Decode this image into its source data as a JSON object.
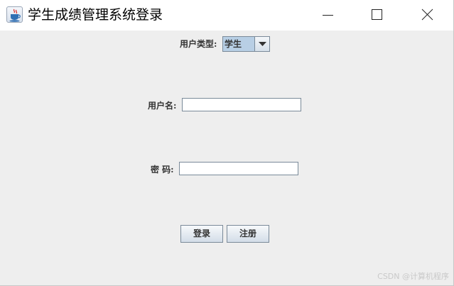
{
  "window": {
    "title": "学生成绩管理系统登录",
    "app_icon": "java-cup-icon",
    "controls": [
      "minimize-icon",
      "maximize-icon",
      "close-icon"
    ]
  },
  "form": {
    "user_type_label": "用户类型:",
    "user_type_value": "学生",
    "username_label": "用户名:",
    "username_value": "",
    "password_label": "密 码:",
    "password_value": "",
    "login_button": "登录",
    "register_button": "注册"
  },
  "watermark": "CSDN @计算机程序",
  "colors": {
    "title_bar": "#ffffff",
    "panel_background": "#eeeeee",
    "combo_background": "#b8cfe5",
    "label_text": "#333333"
  }
}
